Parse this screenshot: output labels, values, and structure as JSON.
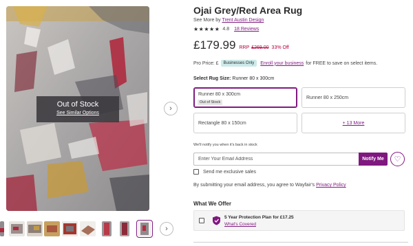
{
  "product": {
    "title": "Ojai Grey/Red Area Rug",
    "byline_prefix": "See More by ",
    "brand": "Trent Austin Design",
    "stars": "★★★★★",
    "rating": "4.8",
    "reviews": "18 Reviews",
    "rating_value": 4.8
  },
  "price": {
    "current": "£179.99",
    "rrp_label": "RRP",
    "rrp_value": "£269.00",
    "discount": "33% Off"
  },
  "pro": {
    "label": "Pro Price: £",
    "badge": "Businesses Only",
    "link": "Enroll your business",
    "suffix": "for FREE to save on select items."
  },
  "size": {
    "label": "Select Rug Size:",
    "selected": "Runner 80 x 300cm",
    "options": [
      {
        "label": "Runner 80 x 300cm",
        "badge": "Out of Stock",
        "selected": true
      },
      {
        "label": "Runner 80 x 250cm"
      },
      {
        "label": "Rectangle 80 x 150cm"
      },
      {
        "label": "+ 13 More"
      }
    ]
  },
  "image": {
    "out_of_stock": "Out of Stock",
    "similar_link": "See Similar Options"
  },
  "notify": {
    "note": "We'll notify you when it's back in stock",
    "email_placeholder": "Enter Your Email Address",
    "button": "Notify Me",
    "exclusive_label": "Send me exclusive sales",
    "agree_prefix": "By submitting your email address, you agree to Wayfair's",
    "privacy_link": "Privacy Policy"
  },
  "offer": {
    "heading": "What We Offer",
    "plan": "5 Year Protection Plan for £17.25",
    "link": "What's Covered"
  },
  "icons": {
    "next_main": "chevron-right-icon",
    "next_thumbs": "chevron-right-icon",
    "wishlist": "heart-icon",
    "protection": "shield-check-icon"
  },
  "colors": {
    "accent": "#7f187f",
    "sale": "#b3003b",
    "pro_badge": "#cdeaea"
  }
}
